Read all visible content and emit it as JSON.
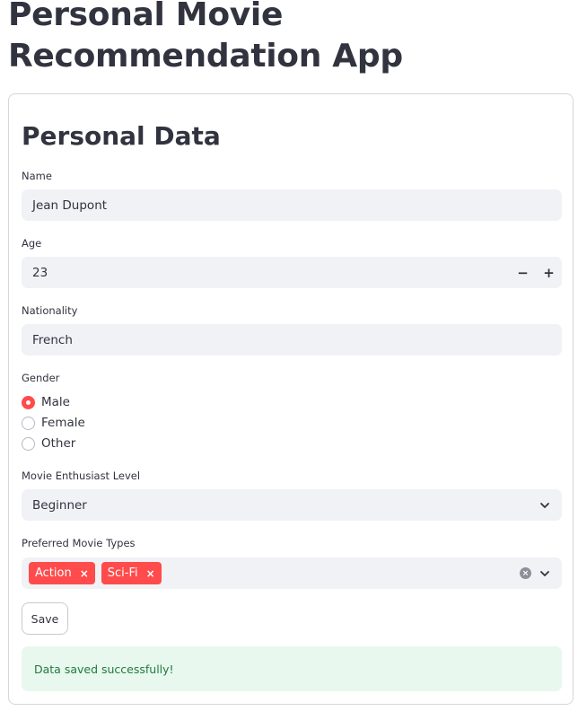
{
  "app": {
    "title": "Personal Movie Recommendation App"
  },
  "form": {
    "section_title": "Personal Data",
    "name": {
      "label": "Name",
      "value": "Jean Dupont"
    },
    "age": {
      "label": "Age",
      "value": "23",
      "decrement": "−",
      "increment": "+"
    },
    "nationality": {
      "label": "Nationality",
      "value": "French"
    },
    "gender": {
      "label": "Gender",
      "options": [
        "Male",
        "Female",
        "Other"
      ],
      "selected": "Male"
    },
    "enthusiast_level": {
      "label": "Movie Enthusiast Level",
      "value": "Beginner"
    },
    "movie_types": {
      "label": "Preferred Movie Types",
      "tags": [
        "Action",
        "Sci-Fi"
      ],
      "remove_glyph": "×",
      "clear_glyph": "×"
    },
    "save_label": "Save",
    "success_message": "Data saved successfully!"
  },
  "colors": {
    "accent": "#ff4b4b",
    "input_bg": "#f0f2f6",
    "success_bg": "#e8f8ee",
    "success_text": "#1f7a3d",
    "text": "#31333f"
  },
  "icons": {
    "dropdown": "chevron-down-icon",
    "clear": "clear-icon",
    "tag_remove": "close-icon"
  }
}
